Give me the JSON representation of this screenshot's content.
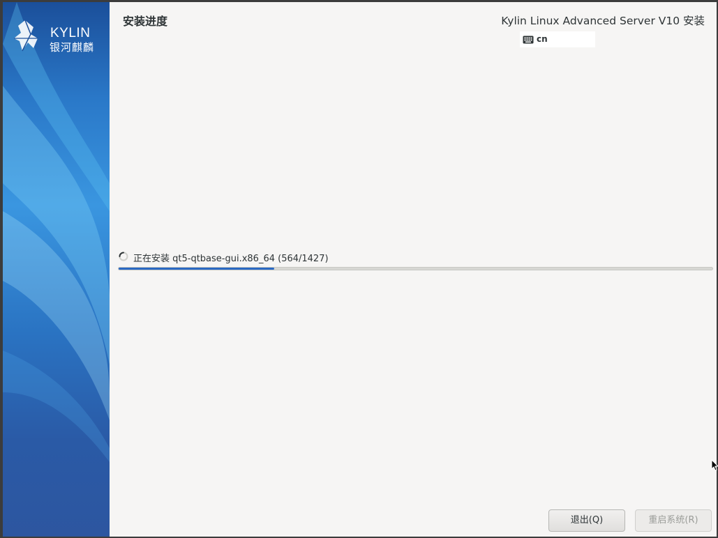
{
  "window": {
    "product_title": "Kylin Linux Advanced Server V10 安装"
  },
  "sidebar": {
    "logo_text": "KYLIN",
    "logo_sub": "银河麒麟"
  },
  "page": {
    "title": "安装进度"
  },
  "keyboard": {
    "icon": "keyboard-icon",
    "layout": "cn"
  },
  "progress": {
    "status_text": "正在安装 qt5-qtbase-gui.x86_64 (564/1427)",
    "fraction": 0.262,
    "accent_color": "#2a69c3"
  },
  "buttons": {
    "quit_label": "退出(Q)",
    "reboot_label": "重启系统(R)"
  }
}
